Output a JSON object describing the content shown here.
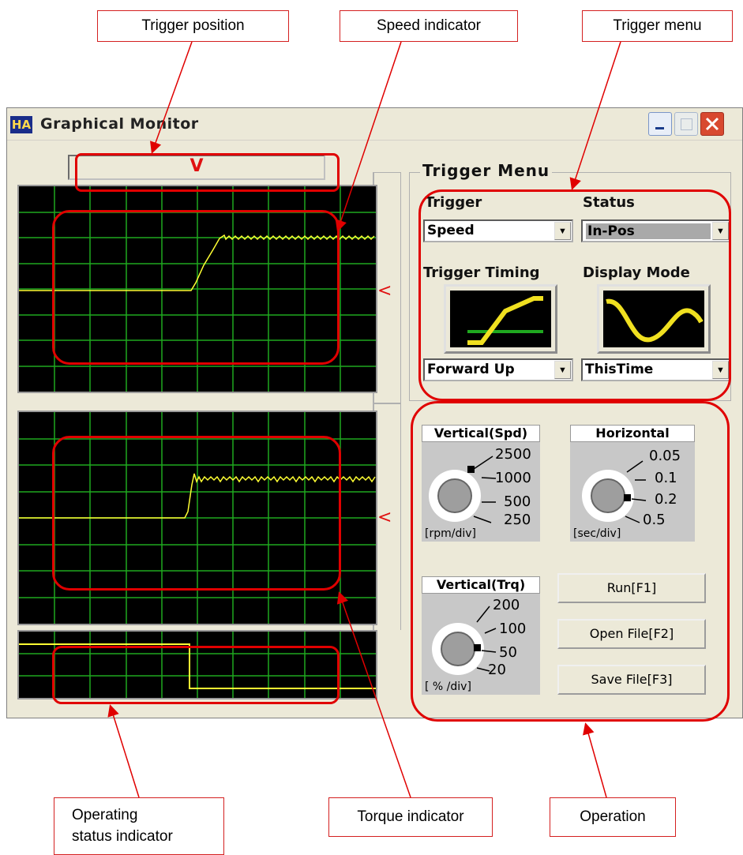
{
  "callouts": {
    "trigger_position": "Trigger position",
    "speed_indicator": "Speed indicator",
    "trigger_menu": "Trigger menu",
    "operating_status_line1": "Operating",
    "operating_status_line2": "status indicator",
    "torque_indicator": "Torque indicator",
    "operation": "Operation"
  },
  "window": {
    "title": "Graphical Monitor",
    "icon_text": "HA"
  },
  "trigger_marker": "V",
  "side_markers": [
    "<",
    "<"
  ],
  "trigger_menu": {
    "group_title": "Trigger Menu",
    "trigger_label": "Trigger",
    "trigger_value": "Speed",
    "status_label": "Status",
    "status_value": "In-Pos",
    "trigger_timing_label": "Trigger Timing",
    "trigger_timing_value": "Forward Up",
    "display_mode_label": "Display Mode",
    "display_mode_value": "ThisTime"
  },
  "dials": {
    "vertical_spd": {
      "title": "Vertical(Spd)",
      "ticks": [
        "2500",
        "1000",
        "500",
        "250"
      ],
      "unit": "[rpm/div]"
    },
    "horizontal": {
      "title": "Horizontal",
      "ticks": [
        "0.05",
        "0.1",
        "0.2",
        "0.5"
      ],
      "unit": "[sec/div]"
    },
    "vertical_trq": {
      "title": "Vertical(Trq)",
      "ticks": [
        "200",
        "100",
        "50",
        "20"
      ],
      "unit": "[ % /div]"
    }
  },
  "buttons": {
    "run": "Run[F1]",
    "open_file": "Open File[F2]",
    "save_file": "Save File[F3]"
  },
  "colors": {
    "callout_border": "#d42020",
    "highlight": "#e00000",
    "trace": "#ffff33",
    "grid": "#1fa81f",
    "screen_bg": "#000000"
  }
}
